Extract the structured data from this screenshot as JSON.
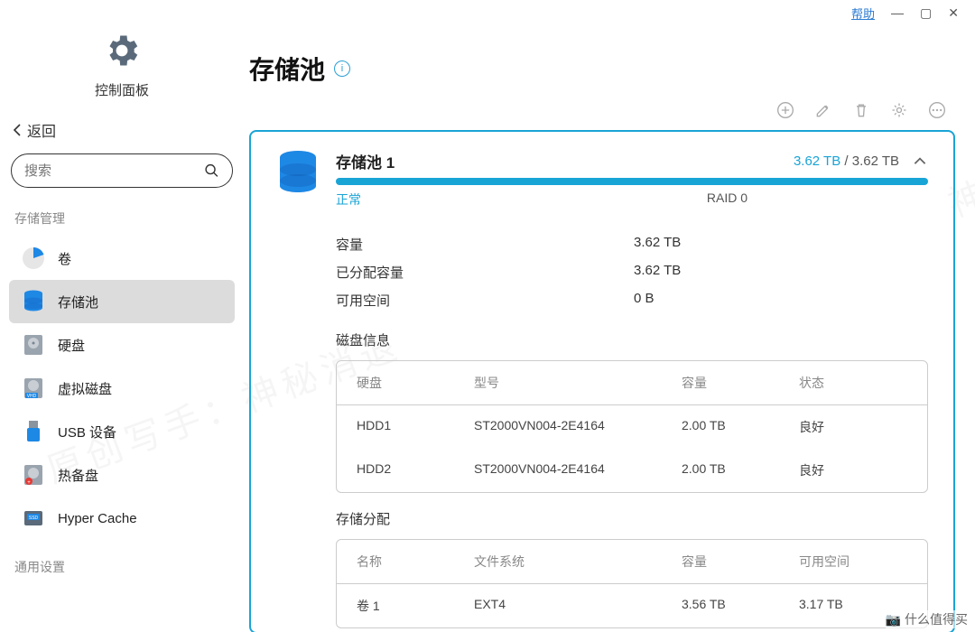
{
  "titlebar": {
    "help": "帮助"
  },
  "sidebar": {
    "cp_title": "控制面板",
    "back": "返回",
    "search_placeholder": "搜索",
    "section1": "存储管理",
    "items": [
      {
        "label": "卷"
      },
      {
        "label": "存储池"
      },
      {
        "label": "硬盘"
      },
      {
        "label": "虚拟磁盘"
      },
      {
        "label": "USB 设备"
      },
      {
        "label": "热备盘"
      },
      {
        "label": "Hyper Cache"
      }
    ],
    "section2": "通用设置"
  },
  "page": {
    "title": "存储池"
  },
  "pool": {
    "name": "存储池 1",
    "status": "正常",
    "raid": "RAID 0",
    "used": "3.62 TB",
    "sep": " / ",
    "total": "3.62 TB",
    "props": [
      {
        "k": "容量",
        "v": "3.62 TB"
      },
      {
        "k": "已分配容量",
        "v": "3.62 TB"
      },
      {
        "k": "可用空间",
        "v": "0 B"
      }
    ]
  },
  "disks": {
    "title": "磁盘信息",
    "headers": {
      "disk": "硬盘",
      "model": "型号",
      "cap": "容量",
      "status": "状态"
    },
    "rows": [
      {
        "disk": "HDD1",
        "model": "ST2000VN004-2E4164",
        "cap": "2.00 TB",
        "status": "良好"
      },
      {
        "disk": "HDD2",
        "model": "ST2000VN004-2E4164",
        "cap": "2.00 TB",
        "status": "良好"
      }
    ]
  },
  "alloc": {
    "title": "存储分配",
    "headers": {
      "name": "名称",
      "fs": "文件系统",
      "cap": "容量",
      "free": "可用空间"
    },
    "rows": [
      {
        "name": "卷 1",
        "fs": "EXT4",
        "cap": "3.56 TB",
        "free": "3.17 TB"
      }
    ]
  },
  "watermark": "什么值得买"
}
